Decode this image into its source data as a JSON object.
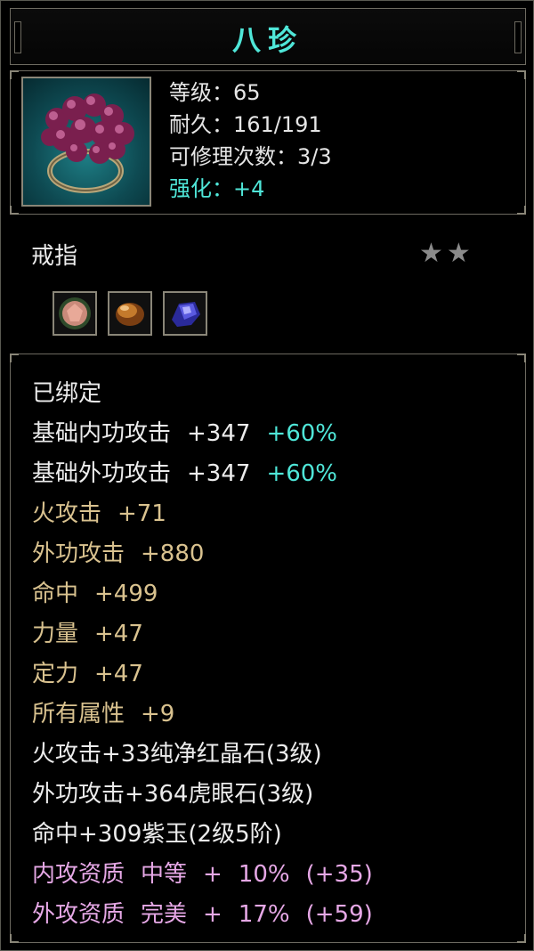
{
  "title": "八珍",
  "info": {
    "level": "等级：65",
    "durability": "耐久：161/191",
    "repair": "可修理次数：3/3",
    "enhance": "强化：+4"
  },
  "item_type": "戒指",
  "stars": {
    "filled": 0,
    "total": 2
  },
  "gems": [
    "red-gem-icon",
    "tiger-eye-icon",
    "purple-jade-icon"
  ],
  "attributes": {
    "bound": "已绑定",
    "base_inner": {
      "label": "基础内功攻击",
      "value": "+347",
      "bonus": "+60%"
    },
    "base_outer": {
      "label": "基础外功攻击",
      "value": "+347",
      "bonus": "+60%"
    },
    "fire": {
      "label": "火攻击",
      "value": "+71"
    },
    "outer_attack": {
      "label": "外功攻击",
      "value": "+880"
    },
    "accuracy": {
      "label": "命中",
      "value": "+499"
    },
    "strength": {
      "label": "力量",
      "value": "+47"
    },
    "focus": {
      "label": "定力",
      "value": "+47"
    },
    "all_attrs": {
      "label": "所有属性",
      "value": "+9"
    },
    "gem1": "火攻击+33纯净红晶石(3级)",
    "gem2": "外功攻击+364虎眼石(3级)",
    "gem3": "命中+309紫玉(2级5阶)",
    "quality_inner": {
      "label": "内攻资质",
      "grade": "中等",
      "plus": "+",
      "pct": "10%",
      "extra": "(+35)"
    },
    "quality_outer": {
      "label": "外攻资质",
      "grade": "完美",
      "plus": "+",
      "pct": "17%",
      "extra": "(+59)"
    }
  },
  "colors": {
    "accent": "#4fe6d8",
    "gold": "#d9c28f",
    "pink": "#e6a8e6",
    "border": "#6d6a60"
  }
}
